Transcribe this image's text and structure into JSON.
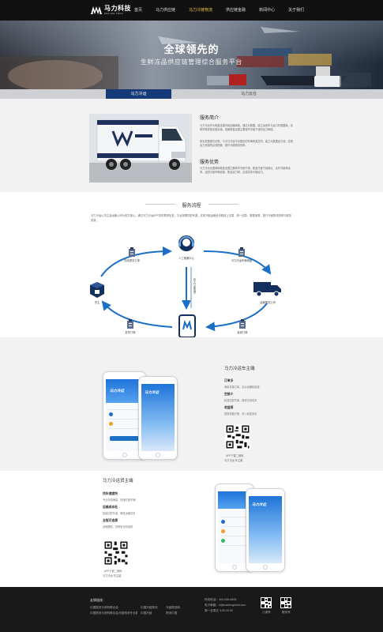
{
  "header": {
    "logo_text": "马力科技",
    "logo_sub": "MALLEE TECH",
    "nav": [
      "首页",
      "马力供应链",
      "马力冷链物流",
      "供应链金融",
      "新闻中心",
      "关于我们"
    ],
    "active_index": 2
  },
  "hero": {
    "title": "全球领先的",
    "subtitle": "生鲜冻品供应链管理综合服务平台"
  },
  "tabs": [
    "马力冷运",
    "马力云仓"
  ],
  "intro": {
    "h1": "服务简介",
    "p1": "马力冷运作为覆盖全国冷链运输网络，通过大数据，建立运营车与运力车数据库，实现货物供需无缝对接，依赖覆盖全国主要城市冷链干线的运力网络。",
    "p2": "依靠发展模式优势，与马力冷运平台整合的车辆资源共同，建立大数据运力池，实现运力资源的高效配置，提升冷链物流效率。",
    "h2": "服务优势",
    "p3": "马力冷运全国网络覆盖全国主要城市冷链干线，覆盖冷链干线网点，合作冷链承运商，全国冷链车辆资源，集结运力网，达成高效冷链运力。"
  },
  "process": {
    "title": "服务流程",
    "desc": "马力冷运以货主及运输公司为双方核心，通过马力冷运APP发布需求信息，平台按需匹配车源，实现冷链运输全流程线上交易，统一结算、数据追溯，提升冷链物流效率与服务质量。",
    "nodes": {
      "center": "人工客服中心",
      "left": "货主",
      "right": "运输物流公司",
      "bottom": "马力冷运APP",
      "tl": "在线提交订单",
      "tr": "马力冷运车辆调度",
      "bl": "发布订单",
      "br": "接收订单",
      "mid": "线上订单管理"
    }
  },
  "app1": {
    "title": "马力冷运车主端",
    "features": [
      {
        "t": "订单多",
        "d": "海量货源订单，高价运输轻松接"
      },
      {
        "t": "空驶少",
        "d": "精准匹配货源，降低空驶成本"
      },
      {
        "t": "收益高",
        "d": "提现快捷方便，收入轻松到手"
      }
    ],
    "qr_caption_1": "APP下载二维码",
    "qr_caption_2": "马力冷运 车主端"
  },
  "app2": {
    "title": "马力冷运货主端",
    "features": [
      {
        "t": "找车速度快",
        "d": "专业车源海量，快速匹配车辆"
      },
      {
        "t": "运输成本低",
        "d": "智能匹配车源，降低运输成本"
      },
      {
        "t": "全程可追溯",
        "d": "全程跟踪，货物安全有保障"
      }
    ],
    "qr_caption_1": "APP下载二维码",
    "qr_caption_2": "马力冷运 货主端"
  },
  "phone": {
    "brand": "马力冷运"
  },
  "footer": {
    "links_title": "友情链接：",
    "links": [
      [
        "中国物流与采购联合会",
        "中国冷链物流"
      ],
      [
        "中国物流与采购联合会冷链物流专业委员会",
        "中国冷链"
      ],
      [
        "冷链物流网",
        "物流中国"
      ]
    ],
    "hotline": "热线电话：400-096-6606",
    "email": "电子邮箱：hi@malleeglobal.com",
    "hours": "周一至周五 9:00-20:00",
    "qr1": "订阅号",
    "qr2": "服务号"
  },
  "colors": {
    "accent_blue": "#1b6fc7",
    "tab_navy": "#163a78",
    "nav_active": "#e7c145"
  }
}
